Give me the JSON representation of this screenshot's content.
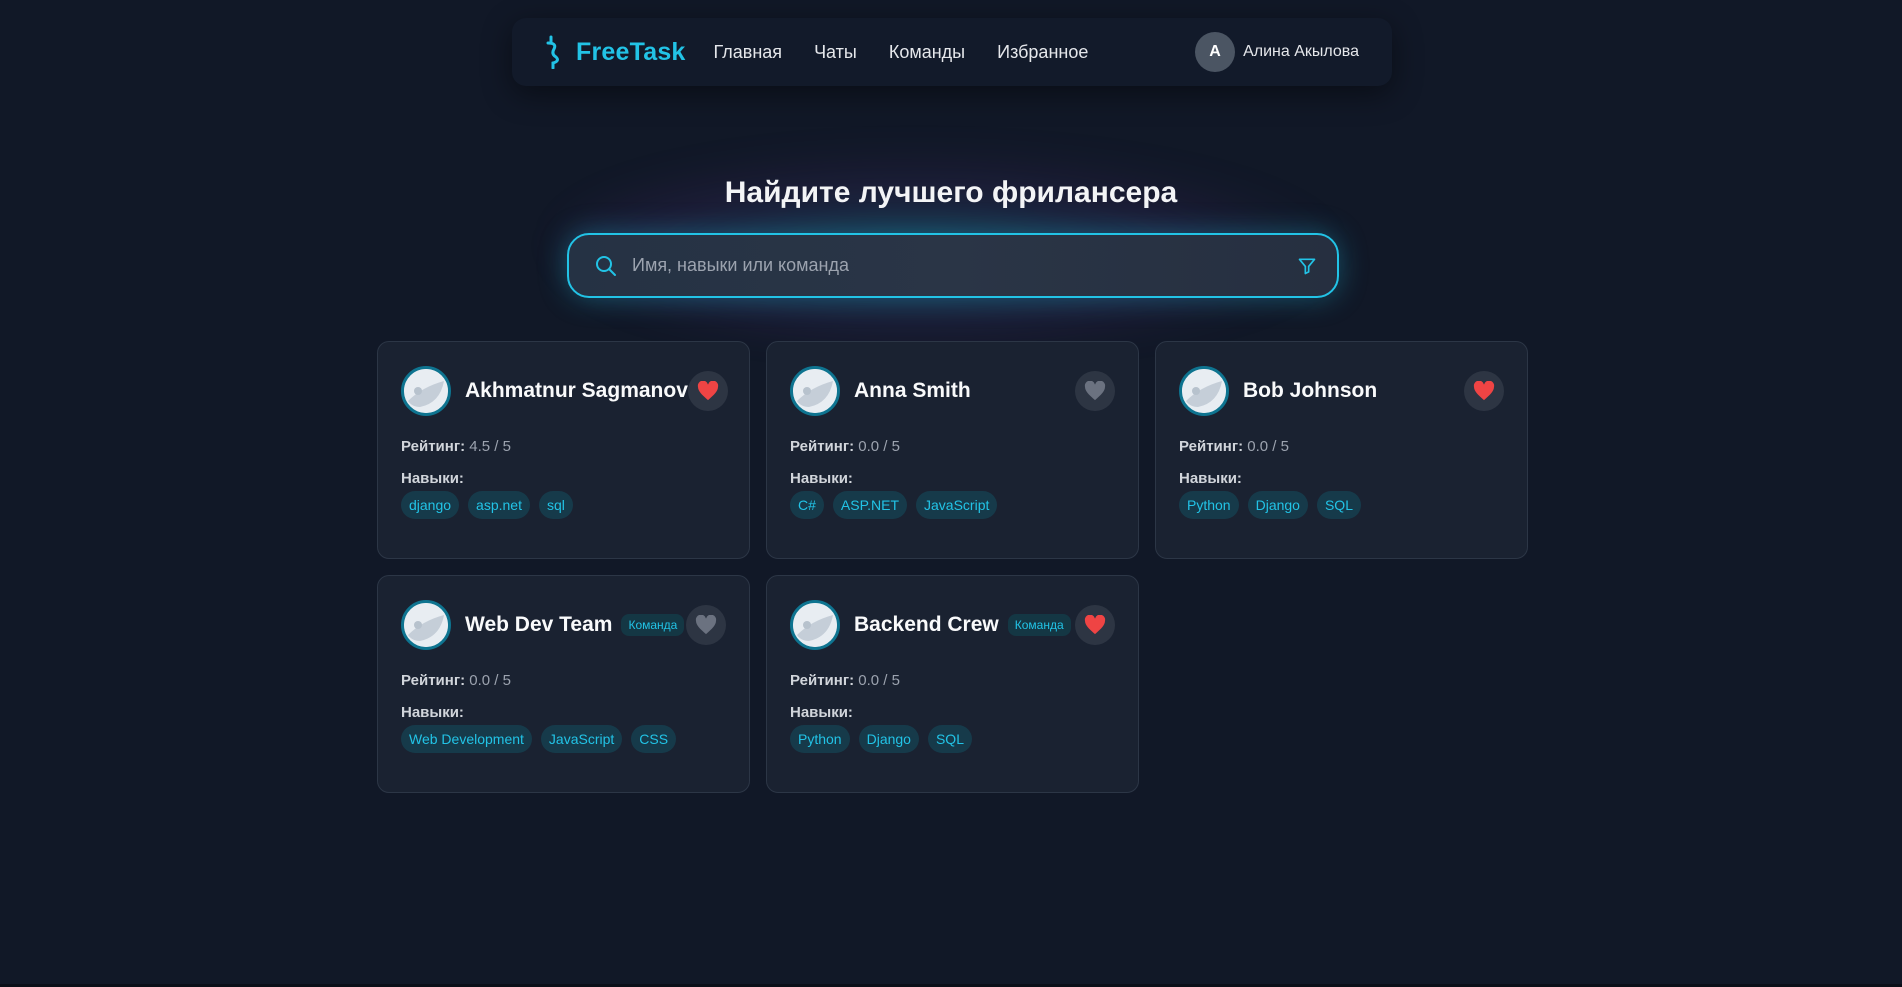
{
  "nav": {
    "logo_text": "FreeTask",
    "links": [
      "Главная",
      "Чаты",
      "Команды",
      "Избранное"
    ],
    "user_initial": "A",
    "user_name": "Алина Акылова"
  },
  "hero": {
    "title": "Найдите лучшего фрилансера",
    "search_placeholder": "Имя, навыки или команда",
    "search_value": ""
  },
  "labels": {
    "rating": "Рейтинг:",
    "skills": "Навыки:"
  },
  "cards": [
    {
      "name": "Akhmatnur Sagmanov",
      "badge": "",
      "rating": "4.5 / 5",
      "favorite": true,
      "skills": [
        "django",
        "asp.net",
        "sql"
      ]
    },
    {
      "name": "Anna Smith",
      "badge": "",
      "rating": "0.0 / 5",
      "favorite": false,
      "skills": [
        "C#",
        "ASP.NET",
        "JavaScript"
      ]
    },
    {
      "name": "Bob Johnson",
      "badge": "",
      "rating": "0.0 / 5",
      "favorite": true,
      "skills": [
        "Python",
        "Django",
        "SQL"
      ]
    },
    {
      "name": "Web Dev Team",
      "badge": "Команда",
      "rating": "0.0 / 5",
      "favorite": false,
      "skills": [
        "Web Development",
        "JavaScript",
        "CSS"
      ]
    },
    {
      "name": "Backend Crew",
      "badge": "Команда",
      "rating": "0.0 / 5",
      "favorite": true,
      "skills": [
        "Python",
        "Django",
        "SQL"
      ]
    }
  ],
  "colors": {
    "background": "#111827",
    "accent": "#22c3e6",
    "favorite_active": "#ef4444",
    "favorite_inactive": "#6b7280",
    "card": "#1a2231"
  }
}
